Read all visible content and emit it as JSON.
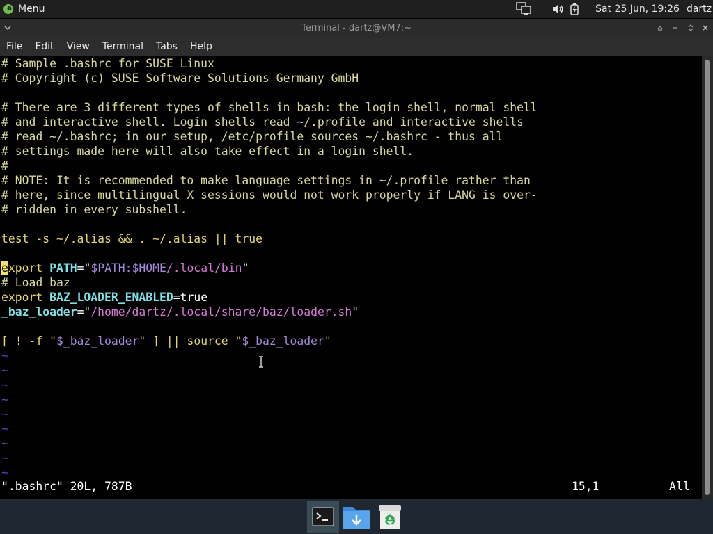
{
  "top_panel": {
    "menu_label": "Menu",
    "clock": "Sat 25 Jun, 19:26",
    "user": "dartz"
  },
  "window": {
    "title": "Terminal - dartz@VM7:~"
  },
  "menubar": {
    "items": [
      "File",
      "Edit",
      "View",
      "Terminal",
      "Tabs",
      "Help"
    ]
  },
  "editor": {
    "comments": {
      "l1": "# Sample .bashrc for SUSE Linux",
      "l2": "# Copyright (c) SUSE Software Solutions Germany GmbH",
      "l4": "# There are 3 different types of shells in bash: the login shell, normal shell",
      "l5": "# and interactive shell. Login shells read ~/.profile and interactive shells",
      "l6": "# read ~/.bashrc; in our setup, /etc/profile sources ~/.bashrc - thus all",
      "l7": "# settings made here will also take effect in a login shell.",
      "l8": "#",
      "l9": "# NOTE: It is recommended to make language settings in ~/.profile rather than",
      "l10": "# here, since multilingual X sessions would not work properly if LANG is over-",
      "l11": "# ridden in every subshell.",
      "l16": "# Load baz"
    },
    "l13": {
      "cmd": "test -s ~/.alias && . ~/.alias || ",
      "kw": "true"
    },
    "l15": {
      "cursor_char": "e",
      "kw_rest": "xport",
      "space": " ",
      "var": "PATH",
      "eq_quote": "=\"",
      "strvar": "$PATH:$HOME",
      "strpath": "/.local/bin",
      "close_quote": "\""
    },
    "l17": {
      "kw": "export",
      "space": " ",
      "var": "BAZ_LOADER_ENABLED",
      "rest": "=true"
    },
    "l18": {
      "var": "_baz_loader",
      "eq_quote": "=\"",
      "strpath": "/home/dartz/.local/share/baz/loader.sh",
      "close_quote": "\""
    },
    "l20": {
      "pre": "[ ! -f \"",
      "strvar1": "$_baz_loader",
      "mid": "\" ] || ",
      "kw": "source",
      "mid2": " \"",
      "strvar2": "$_baz_loader",
      "post": "\""
    },
    "tilde": "~",
    "status": {
      "file": "\".bashrc\" 20L, 787B",
      "position": "15,1",
      "scroll": "All"
    }
  }
}
